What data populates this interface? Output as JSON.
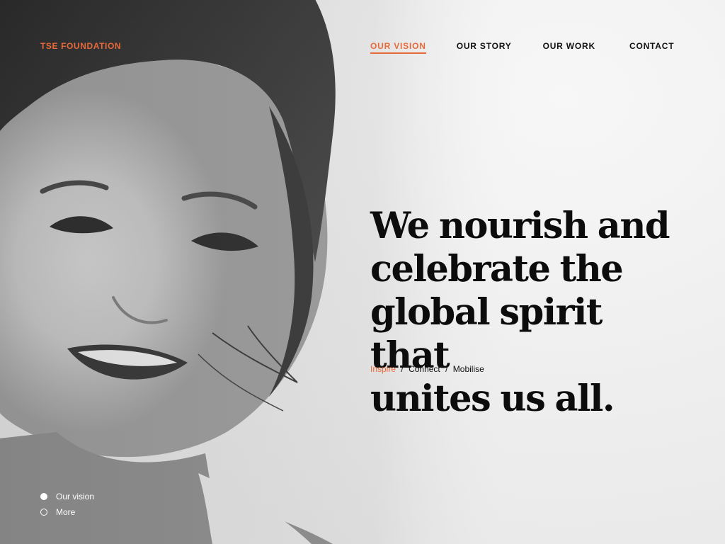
{
  "brand": {
    "name": "TSE FOUNDATION"
  },
  "nav": {
    "items": [
      {
        "label": "OUR VISION",
        "active": true
      },
      {
        "label": "OUR STORY",
        "active": false
      },
      {
        "label": "OUR WORK",
        "active": false
      },
      {
        "label": "CONTACT",
        "active": false
      }
    ]
  },
  "hero": {
    "headline_lines": [
      "We nourish and",
      "celebrate the",
      "global spirit that",
      "unites us all."
    ],
    "tagline": {
      "accent": "Inspire",
      "separator": "/",
      "rest": [
        "Connect",
        "Mobilise"
      ]
    }
  },
  "slider": {
    "items": [
      {
        "label": "Our vision",
        "active": true
      },
      {
        "label": "More",
        "active": false
      }
    ]
  },
  "colors": {
    "accent": "#e86a3a",
    "text": "#111111",
    "background": "#efefef"
  },
  "icons": {
    "slide-active": "filled-circle",
    "slide-inactive": "hollow-circle"
  }
}
